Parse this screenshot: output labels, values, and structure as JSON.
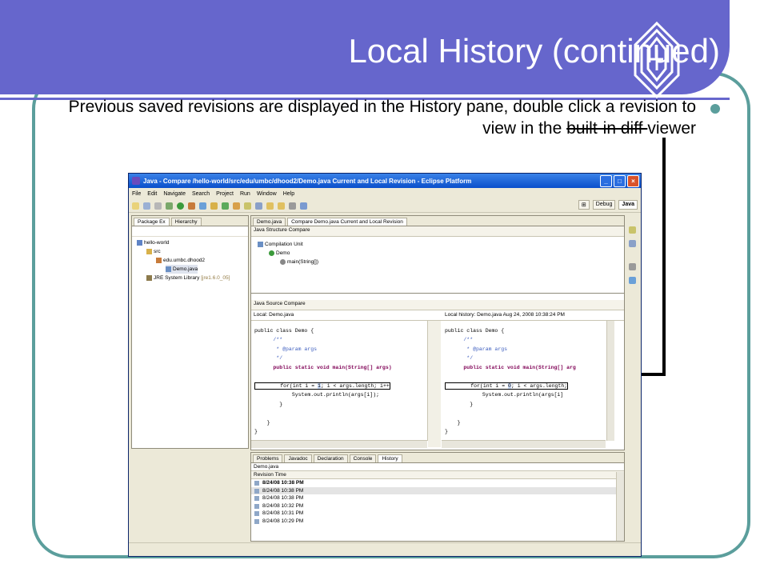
{
  "slide": {
    "title": "Local History (continued)",
    "caption_main": "Previous saved revisions are displayed in the History pane, double click a revision to view in the ",
    "caption_strike": "built-in diff ",
    "caption_end": "viewer"
  },
  "window": {
    "title": "Java - Compare /hello-world/src/edu/umbc/dhood2/Demo.java Current and Local Revision - Eclipse Platform",
    "menu": [
      "File",
      "Edit",
      "Navigate",
      "Search",
      "Project",
      "Run",
      "Window",
      "Help"
    ],
    "perspectives": {
      "debug": "Debug",
      "java": "Java"
    }
  },
  "left_panel": {
    "tabs": [
      "Package Ex",
      "Hierarchy"
    ],
    "tree": {
      "project": "hello-world",
      "src": "src",
      "package": "edu.umbc.dhood2",
      "file": "Demo.java",
      "jre": "JRE System Library",
      "jre_version": "[jre1.6.0_05]"
    }
  },
  "editor": {
    "tabs": [
      "Demo.java",
      "Compare Demo.java Current and Local Revision"
    ],
    "structure_title": "Java Structure Compare",
    "structure_tree": [
      "Compilation Unit",
      "Demo",
      "main(String[])"
    ],
    "source_title": "Java Source Compare",
    "left_label": "Local: Demo.java",
    "right_label": "Local history: Demo.java Aug 24, 2008 10:38:24 PM"
  },
  "code_left": {
    "top": "public class Demo {",
    "l1": "/**",
    "l2": " * @param args",
    "l3": " */",
    "l4": "public static void main(String[] args)",
    "l5a": "for(int i = ",
    "l5b": "1",
    "l5c": "; i < args.length; i++",
    "l6": "System.out.println(args[i]);",
    "l7": "}",
    "l8": "}",
    "l9": "}"
  },
  "code_right": {
    "top": "public class Demo {",
    "l1": "/**",
    "l2": " * @param args",
    "l3": " */",
    "l4": "public static void main(String[] arg",
    "l5a": "for(int i = ",
    "l5b": "0",
    "l5c": "; i < args.length;",
    "l6": "System.out.println(args[i]",
    "l7": "}",
    "l8": "}",
    "l9": "}"
  },
  "bottom_panel": {
    "tabs": [
      "Problems",
      "Javadoc",
      "Declaration",
      "Console",
      "History"
    ],
    "file": "Demo.java",
    "column": "Revision Time",
    "revisions": [
      "8/24/08 10:38 PM",
      "8/24/08 10:38 PM",
      "8/24/08 10:38 PM",
      "8/24/08 10:32 PM",
      "8/24/08 10:31 PM",
      "8/24/08 10:29 PM"
    ]
  },
  "colors": {
    "accent": "#6666cc",
    "frame": "#5b9e9c"
  }
}
